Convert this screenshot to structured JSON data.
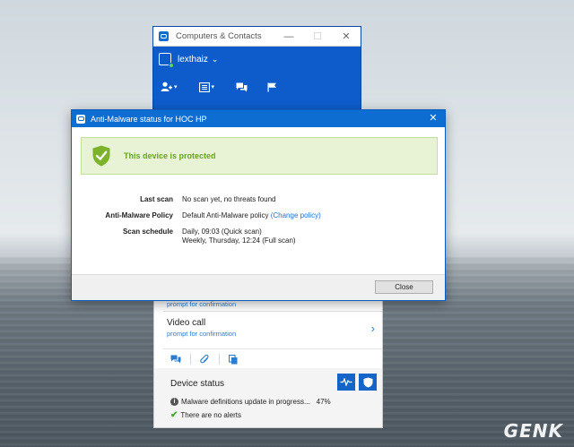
{
  "computers_contacts": {
    "title": "Computers & Contacts",
    "window_controls": [
      "—",
      "☐",
      "✕"
    ],
    "username": "lexthaiz",
    "user_chevron": "⌄",
    "toolbar_icons": [
      "add-contact-icon",
      "list-icon",
      "chat-icon",
      "flag-icon"
    ]
  },
  "lower_panel": {
    "prompt_text": "prompt for confirmation",
    "video_call": {
      "title": "Video call",
      "subtitle": "prompt for confirmation"
    },
    "action_icons": [
      "chat-icon",
      "attachment-icon",
      "copy-icon"
    ],
    "device_status": {
      "title": "Device status",
      "malware_update": "Malware definitions update in progress...",
      "progress_percent": "47%",
      "no_alerts": "There are no alerts"
    }
  },
  "anti_malware": {
    "title": "Anti-Malware status for HOC HP",
    "close_glyph": "✕",
    "status_text": "This device is protected",
    "rows": {
      "last_scan": {
        "label": "Last scan",
        "value": "No scan yet, no threats found"
      },
      "policy": {
        "label": "Anti-Malware Policy",
        "value": "Default Anti-Malware policy",
        "link": "(Change policy)"
      },
      "schedule": {
        "label": "Scan schedule",
        "line1": "Daily, 09:03 (Quick scan)",
        "line2": "Weekly, Thursday, 12:24 (Full scan)"
      }
    },
    "close_button": "Close"
  },
  "watermark": "GENK",
  "colors": {
    "teamviewer_blue": "#0e5ccc",
    "protected_green": "#6aa51f",
    "banner_bg": "#e8f3d6",
    "link_blue": "#2a7ed2"
  }
}
